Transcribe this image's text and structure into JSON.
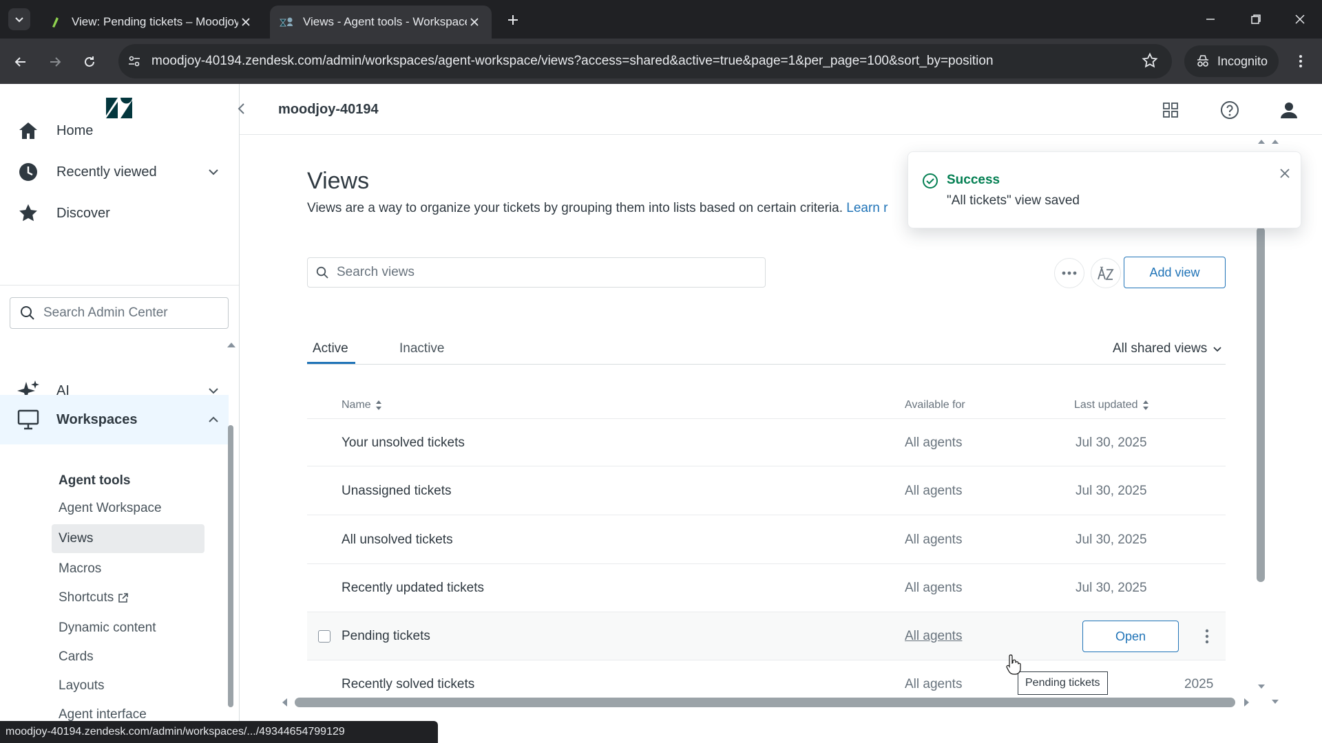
{
  "browser": {
    "tabs": [
      {
        "title": "View: Pending tickets – Moodjoy",
        "active": false
      },
      {
        "title": "Views - Agent tools - Workspace",
        "active": true
      }
    ],
    "url": "moodjoy-40194.zendesk.com/admin/workspaces/agent-workspace/views?access=shared&active=true&page=1&per_page=100&sort_by=position",
    "incognito_label": "Incognito",
    "status_url": "moodjoy-40194.zendesk.com/admin/workspaces/.../49344654799129"
  },
  "header": {
    "account_name": "moodjoy-40194"
  },
  "sidebar": {
    "nav": [
      {
        "label": "Home",
        "icon": "home-icon"
      },
      {
        "label": "Recently viewed",
        "icon": "clock-icon"
      },
      {
        "label": "Discover",
        "icon": "star-icon"
      },
      {
        "label": "AI",
        "icon": "sparkle-icon"
      },
      {
        "label": "Workspaces",
        "icon": "monitor-icon"
      }
    ],
    "search_placeholder": "Search Admin Center",
    "sub_heading": "Agent tools",
    "sub_items": [
      "Agent Workspace",
      "Views",
      "Macros",
      "Shortcuts",
      "Dynamic content",
      "Cards",
      "Layouts",
      "Agent interface"
    ]
  },
  "page": {
    "title": "Views",
    "description": "Views are a way to organize your tickets by grouping them into lists based on certain criteria.",
    "learn_link": "Learn r",
    "search_placeholder": "Search views",
    "add_view_label": "Add view",
    "tabs": [
      {
        "label": "Active"
      },
      {
        "label": "Inactive"
      }
    ],
    "filter_label": "All shared views",
    "columns": {
      "name": "Name",
      "available": "Available for",
      "updated": "Last updated"
    },
    "rows": [
      {
        "name": "Your unsolved tickets",
        "available": "All agents",
        "updated": "Jul 30, 2025"
      },
      {
        "name": "Unassigned tickets",
        "available": "All agents",
        "updated": "Jul 30, 2025"
      },
      {
        "name": "All unsolved tickets",
        "available": "All agents",
        "updated": "Jul 30, 2025"
      },
      {
        "name": "Recently updated tickets",
        "available": "All agents",
        "updated": "Jul 30, 2025"
      },
      {
        "name": "Pending tickets",
        "available": "All agents",
        "updated": ""
      },
      {
        "name": "Recently solved tickets",
        "available": "All agents",
        "updated": "2025"
      }
    ],
    "open_label": "Open",
    "tooltip": "Pending tickets"
  },
  "toast": {
    "title": "Success",
    "message": "\"All tickets\" view saved"
  },
  "colors": {
    "accent": "#1f73b7",
    "success": "#037f52",
    "sidebar_active": "#edf7ff"
  }
}
